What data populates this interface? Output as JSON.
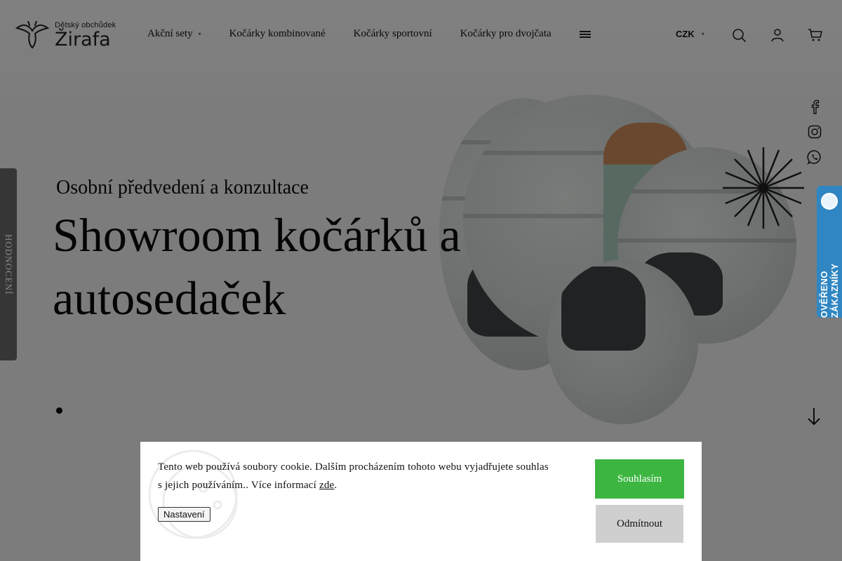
{
  "header": {
    "logo": {
      "small": "Dětský obchůdek",
      "big": "Žirafa"
    },
    "nav": [
      {
        "label": "Akční sety",
        "has_dropdown": true
      },
      {
        "label": "Kočárky kombinované"
      },
      {
        "label": "Kočárky sportovní"
      },
      {
        "label": "Kočárky pro dvojčata"
      }
    ],
    "currency": "CZK",
    "icons": [
      "search-icon",
      "user-icon",
      "cart-icon"
    ]
  },
  "social": [
    "facebook-icon",
    "instagram-icon",
    "whatsapp-icon"
  ],
  "hero": {
    "subtitle": "Osobní předvedení a konzultace",
    "title": "Showroom kočárků a autosedaček"
  },
  "side_tabs": {
    "reviews": "HODNOCENÍ",
    "verified": "OVĚŘENO ZÁKAZNÍKY"
  },
  "cookie": {
    "text_before": "Tento web používá soubory cookie. Dalším procházením tohoto webu vyjadřujete souhlas s jejich používáním.. Více informací",
    "link": "zde",
    "text_after": ".",
    "settings": "Nastavení",
    "agree": "Souhlasím",
    "decline": "Odmítnout"
  },
  "colors": {
    "agree": "#3cb541",
    "verified": "#2f86c2",
    "reviews_tab": "#363636",
    "overlay": "rgba(0,0,0,0.48)"
  }
}
